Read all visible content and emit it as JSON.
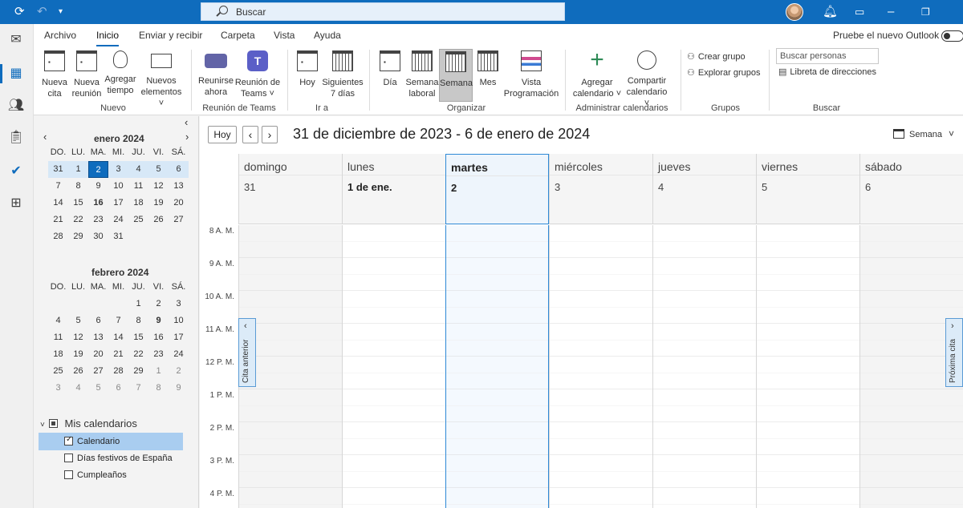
{
  "titlebar": {
    "search_placeholder": "Buscar"
  },
  "menu": {
    "items": [
      "Archivo",
      "Inicio",
      "Enviar y recibir",
      "Carpeta",
      "Vista",
      "Ayuda"
    ],
    "try_new_outlook": "Pruebe el nuevo Outlook"
  },
  "ribbon": {
    "nueva_cita": "Nueva cita",
    "nueva_reunion": "Nueva reunión",
    "agregar_tiempo": "Agregar tiempo",
    "nuevos_elementos": "Nuevos elementos ˅",
    "group_nuevo": "Nuevo",
    "reunirse_ahora": "Reunirse ahora",
    "reunion_teams": "Reunión de Teams ˅",
    "group_teams": "Reunión de Teams",
    "hoy": "Hoy",
    "siguientes_7": "Siguientes 7 días",
    "group_ira": "Ir a",
    "dia": "Día",
    "semana_laboral": "Semana laboral",
    "semana": "Semana",
    "mes": "Mes",
    "vista_programacion": "Vista Programación",
    "group_organizar": "Organizar",
    "agregar_calendario": "Agregar calendario ˅",
    "compartir_calendario": "Compartir calendario ˅",
    "group_administrar": "Administrar calendarios",
    "crear_grupo": "Crear grupo",
    "explorar_grupos": "Explorar grupos",
    "group_grupos": "Grupos",
    "buscar_personas": "Buscar personas",
    "libreta": "Libreta de direcciones",
    "group_buscar": "Buscar"
  },
  "sidebar": {
    "jan_title": "enero 2024",
    "feb_title": "febrero 2024",
    "weekdays": [
      "DO.",
      "LU.",
      "MA.",
      "MI.",
      "JU.",
      "VI.",
      "SÁ."
    ],
    "jan_days": [
      "31",
      "1",
      "2",
      "3",
      "4",
      "5",
      "6",
      "7",
      "8",
      "9",
      "10",
      "11",
      "12",
      "13",
      "14",
      "15",
      "16",
      "17",
      "18",
      "19",
      "20",
      "21",
      "22",
      "23",
      "24",
      "25",
      "26",
      "27",
      "28",
      "29",
      "30",
      "31"
    ],
    "feb_days": [
      "",
      "",
      "",
      "",
      "1",
      "2",
      "3",
      "4",
      "5",
      "6",
      "7",
      "8",
      "9",
      "10",
      "11",
      "12",
      "13",
      "14",
      "15",
      "16",
      "17",
      "18",
      "19",
      "20",
      "21",
      "22",
      "23",
      "24",
      "25",
      "26",
      "27",
      "28",
      "29",
      "1",
      "2",
      "3",
      "4",
      "5",
      "6",
      "7",
      "8",
      "9"
    ],
    "mis_calendarios": "Mis calendarios",
    "calendars": [
      {
        "label": "Calendario",
        "checked": true
      },
      {
        "label": "Días festivos de España",
        "checked": false
      },
      {
        "label": "Cumpleaños",
        "checked": false
      }
    ]
  },
  "main": {
    "hoy_label": "Hoy",
    "date_range": "31 de diciembre de 2023 - 6 de enero de 2024",
    "view_label": "Semana",
    "days": [
      {
        "name": "domingo",
        "date": "31"
      },
      {
        "name": "lunes",
        "date": "1 de ene."
      },
      {
        "name": "martes",
        "date": "2"
      },
      {
        "name": "miércoles",
        "date": "3"
      },
      {
        "name": "jueves",
        "date": "4"
      },
      {
        "name": "viernes",
        "date": "5"
      },
      {
        "name": "sábado",
        "date": "6"
      }
    ],
    "hours": [
      "8 A. M.",
      "9 A. M.",
      "10 A. M.",
      "11 A. M.",
      "12 P. M.",
      "1 P. M.",
      "2 P. M.",
      "3 P. M.",
      "4 P. M."
    ],
    "prev_appt": "Cita anterior",
    "next_appt": "Próxima cita"
  },
  "colors": {
    "accent": "#0f6cbd"
  }
}
